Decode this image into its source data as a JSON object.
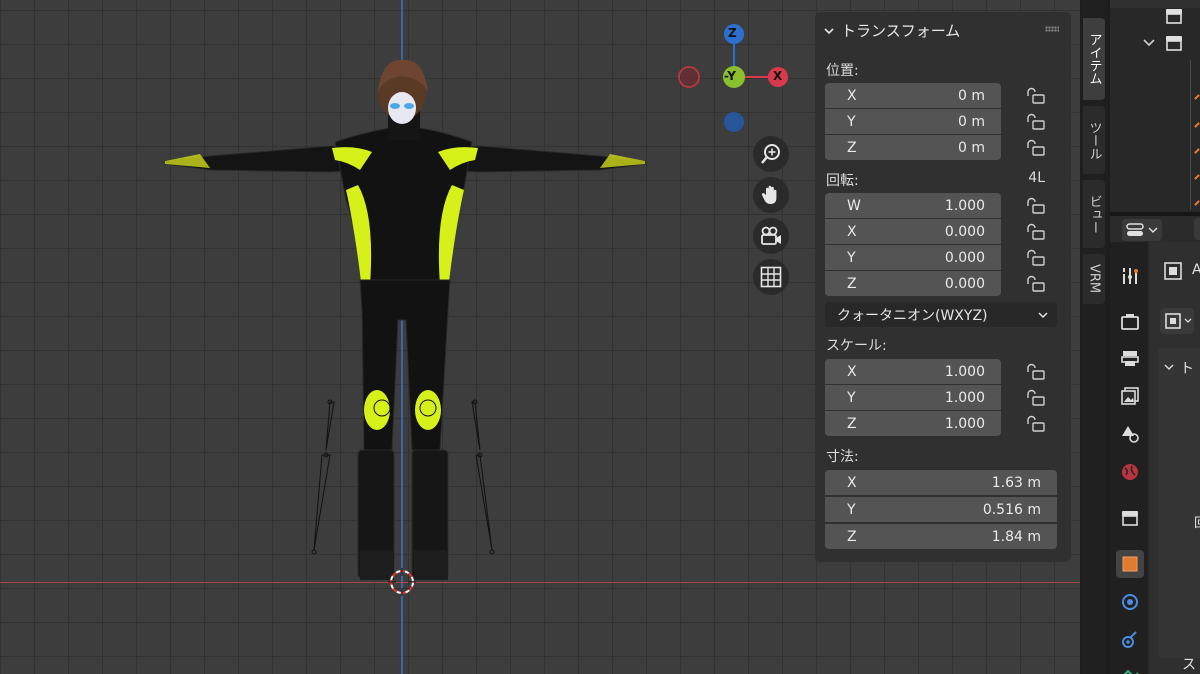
{
  "panel": {
    "title": "トランスフォーム",
    "location_label": "位置:",
    "location": [
      {
        "axis": "X",
        "value": "0 m"
      },
      {
        "axis": "Y",
        "value": "0 m"
      },
      {
        "axis": "Z",
        "value": "0 m"
      }
    ],
    "rotation_label": "回転:",
    "rotation_extra": "4L",
    "rotation": [
      {
        "axis": "W",
        "value": "1.000"
      },
      {
        "axis": "X",
        "value": "0.000"
      },
      {
        "axis": "Y",
        "value": "0.000"
      },
      {
        "axis": "Z",
        "value": "0.000"
      }
    ],
    "rotation_mode": "クォータニオン(WXYZ)",
    "scale_label": "スケール:",
    "scale": [
      {
        "axis": "X",
        "value": "1.000"
      },
      {
        "axis": "Y",
        "value": "1.000"
      },
      {
        "axis": "Z",
        "value": "1.000"
      }
    ],
    "dimensions_label": "寸法:",
    "dimensions": [
      {
        "axis": "X",
        "value": "1.63 m"
      },
      {
        "axis": "Y",
        "value": "0.516 m"
      },
      {
        "axis": "Z",
        "value": "1.84 m"
      }
    ]
  },
  "tabs": [
    "アイテム",
    "ツール",
    "ビュー",
    "VRM"
  ],
  "gizmo": {
    "z": "Z",
    "y": "-Y",
    "x": "X"
  },
  "props_fragments": {
    "row1": "A",
    "row2": "ト",
    "row3": "回",
    "row4": "ス"
  },
  "colors": {
    "accent_yellow": "#d6f01a",
    "axis_x": "#d9394d",
    "axis_y": "#8bbf2e",
    "axis_z": "#2d6fcf",
    "active_tab": "#e07a2f"
  }
}
